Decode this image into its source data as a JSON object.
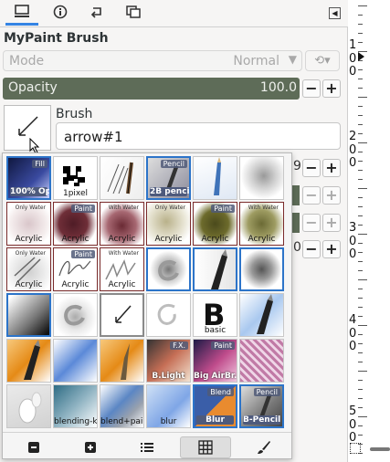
{
  "tabs": [
    {
      "icon": "brush-settings-icon"
    },
    {
      "icon": "info-icon"
    },
    {
      "icon": "undo-history-icon"
    },
    {
      "icon": "layers-icon"
    }
  ],
  "title": "MyPaint Brush",
  "mode": {
    "label": "Mode",
    "value": "Normal"
  },
  "opacity": {
    "label": "Opacity",
    "value": "100.0"
  },
  "brush": {
    "label": "Brush",
    "name": "arrow#1"
  },
  "partial_side_values": [
    "9",
    "0"
  ],
  "brushes": [
    {
      "caption": "100% Op.",
      "tag": "Fill"
    },
    {
      "caption": "1pixel",
      "tag": ""
    },
    {
      "caption": "",
      "tag": ""
    },
    {
      "caption": "2B pencil",
      "tag": "Pencil"
    },
    {
      "caption": "",
      "tag": ""
    },
    {
      "caption": "",
      "tag": ""
    },
    {
      "caption": "Acrylic",
      "tag": "Only Water"
    },
    {
      "caption": "Acrylic",
      "tag": "Paint"
    },
    {
      "caption": "Acrylic",
      "tag": "With Water"
    },
    {
      "caption": "Acrylic",
      "tag": "Only Water"
    },
    {
      "caption": "Acrylic",
      "tag": "Paint"
    },
    {
      "caption": "Acrylic",
      "tag": "With Water"
    },
    {
      "caption": "Acrylic",
      "tag": "Only Water"
    },
    {
      "caption": "Acrylic",
      "tag": "Paint"
    },
    {
      "caption": "Acrylic",
      "tag": "With Water"
    },
    {
      "caption": "",
      "tag": ""
    },
    {
      "caption": "",
      "tag": ""
    },
    {
      "caption": "",
      "tag": ""
    },
    {
      "caption": "",
      "tag": ""
    },
    {
      "caption": "",
      "tag": ""
    },
    {
      "caption": "",
      "tag": ""
    },
    {
      "caption": "",
      "tag": ""
    },
    {
      "caption": "basic",
      "tag": ""
    },
    {
      "caption": "",
      "tag": ""
    },
    {
      "caption": "",
      "tag": ""
    },
    {
      "caption": "",
      "tag": ""
    },
    {
      "caption": "",
      "tag": ""
    },
    {
      "caption": "B.Light",
      "tag": "F.X."
    },
    {
      "caption": "Big AirBr.",
      "tag": "Paint"
    },
    {
      "caption": "",
      "tag": ""
    },
    {
      "caption": "",
      "tag": ""
    },
    {
      "caption": "blending-knife",
      "tag": ""
    },
    {
      "caption": "blend+paint",
      "tag": ""
    },
    {
      "caption": "blur",
      "tag": ""
    },
    {
      "caption": "Blur",
      "tag": "Blend"
    },
    {
      "caption": "B-Pencil",
      "tag": "Pencil"
    }
  ],
  "ruler": [
    "1",
    "0",
    "0",
    "2",
    "0",
    "0",
    "3",
    "0",
    "0",
    "4",
    "0",
    "0",
    "5",
    "0",
    "0"
  ],
  "popup_toolbar": [
    {
      "icon": "zoom-out-icon"
    },
    {
      "icon": "zoom-in-icon"
    },
    {
      "icon": "list-view-icon"
    },
    {
      "icon": "grid-view-icon"
    },
    {
      "icon": "edit-brush-icon"
    }
  ],
  "colors": {
    "accent": "#3584e4",
    "slider": "#5e6c58",
    "selected_border": "#2c74c9"
  }
}
